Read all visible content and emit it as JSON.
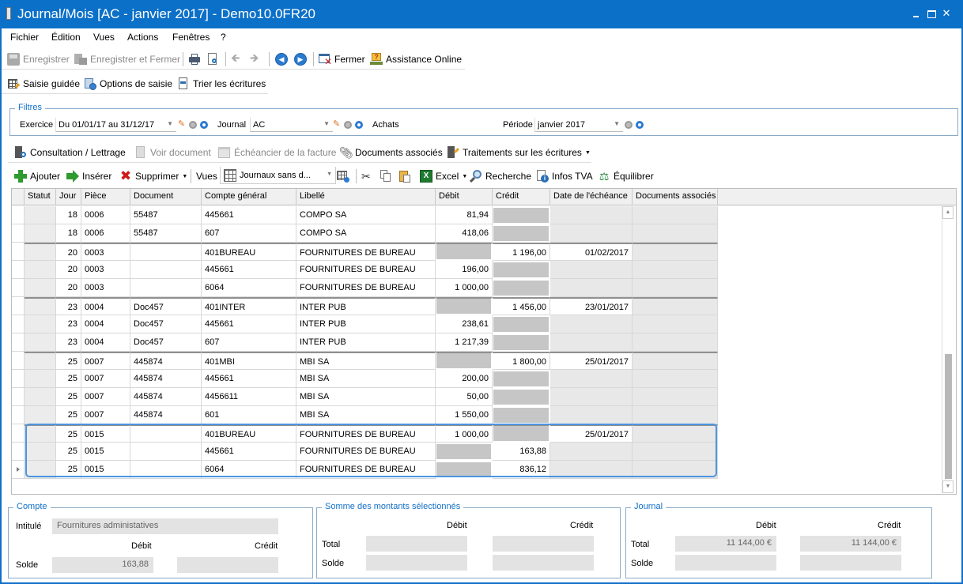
{
  "window": {
    "title": "Journal/Mois [AC - janvier 2017] - Demo10.0FR20",
    "controls": {
      "minimize": "minimize",
      "maximize": "maximize",
      "close": "✕"
    }
  },
  "menu": [
    "Fichier",
    "Édition",
    "Vues",
    "Actions",
    "Fenêtres",
    "?"
  ],
  "toolbar1": {
    "save": "Enregistrer",
    "save_close": "Enregistrer et Fermer",
    "close": "Fermer",
    "assistance": "Assistance Online"
  },
  "toolbar2": {
    "guided": "Saisie guidée",
    "options": "Options de saisie",
    "sort": "Trier les écritures"
  },
  "filters": {
    "legend": "Filtres",
    "exercice_label": "Exercice",
    "exercice_value": "Du 01/01/17 au 31/12/17",
    "journal_label": "Journal",
    "journal_value": "AC",
    "journal_name": "Achats",
    "periode_label": "Période",
    "periode_value": "janvier 2017"
  },
  "actions": {
    "consultation": "Consultation / Lettrage",
    "voir_document": "Voir document",
    "echeancier": "Échéancier de la facture",
    "documents": "Documents associés",
    "traitements": "Traitements sur les écritures"
  },
  "edit": {
    "add": "Ajouter",
    "insert": "Insérer",
    "delete": "Supprimer",
    "vues_label": "Vues",
    "vues_value": "Journaux sans d...",
    "excel": "Excel",
    "search": "Recherche",
    "tva": "Infos TVA",
    "balance": "Équilibrer"
  },
  "grid": {
    "columns": [
      "Statut",
      "Jour",
      "Pièce",
      "Document",
      "Compte général",
      "Libellé",
      "Débit",
      "Crédit",
      "Date de l'échéance",
      "Documents associés"
    ],
    "rows": [
      {
        "jour": "18",
        "piece": "0006",
        "document": "55487",
        "compte": "445661",
        "libelle": "COMPO SA",
        "debit": "81,94",
        "credit": "",
        "echeance": ""
      },
      {
        "jour": "18",
        "piece": "0006",
        "document": "55487",
        "compte": "607",
        "libelle": "COMPO SA",
        "debit": "418,06",
        "credit": "",
        "echeance": ""
      },
      {
        "jour": "20",
        "piece": "0003",
        "document": "",
        "compte": "401BUREAU",
        "libelle": "FOURNITURES DE BUREAU",
        "debit": "",
        "credit": "1 196,00",
        "echeance": "01/02/2017"
      },
      {
        "jour": "20",
        "piece": "0003",
        "document": "",
        "compte": "445661",
        "libelle": "FOURNITURES DE BUREAU",
        "debit": "196,00",
        "credit": "",
        "echeance": ""
      },
      {
        "jour": "20",
        "piece": "0003",
        "document": "",
        "compte": "6064",
        "libelle": "FOURNITURES DE BUREAU",
        "debit": "1 000,00",
        "credit": "",
        "echeance": ""
      },
      {
        "jour": "23",
        "piece": "0004",
        "document": "Doc457",
        "compte": "401INTER",
        "libelle": "INTER PUB",
        "debit": "",
        "credit": "1 456,00",
        "echeance": "23/01/2017"
      },
      {
        "jour": "23",
        "piece": "0004",
        "document": "Doc457",
        "compte": "445661",
        "libelle": "INTER PUB",
        "debit": "238,61",
        "credit": "",
        "echeance": ""
      },
      {
        "jour": "23",
        "piece": "0004",
        "document": "Doc457",
        "compte": "607",
        "libelle": "INTER PUB",
        "debit": "1 217,39",
        "credit": "",
        "echeance": ""
      },
      {
        "jour": "25",
        "piece": "0007",
        "document": "445874",
        "compte": "401MBI",
        "libelle": "MBI SA",
        "debit": "",
        "credit": "1 800,00",
        "echeance": "25/01/2017"
      },
      {
        "jour": "25",
        "piece": "0007",
        "document": "445874",
        "compte": "445661",
        "libelle": "MBI SA",
        "debit": "200,00",
        "credit": "",
        "echeance": ""
      },
      {
        "jour": "25",
        "piece": "0007",
        "document": "445874",
        "compte": "4456611",
        "libelle": "MBI SA",
        "debit": "50,00",
        "credit": "",
        "echeance": ""
      },
      {
        "jour": "25",
        "piece": "0007",
        "document": "445874",
        "compte": "601",
        "libelle": "MBI SA",
        "debit": "1 550,00",
        "credit": "",
        "echeance": ""
      },
      {
        "jour": "25",
        "piece": "0015",
        "document": "",
        "compte": "401BUREAU",
        "libelle": "FOURNITURES DE BUREAU",
        "debit": "1 000,00",
        "credit": "",
        "echeance": "25/01/2017"
      },
      {
        "jour": "25",
        "piece": "0015",
        "document": "",
        "compte": "445661",
        "libelle": "FOURNITURES DE BUREAU",
        "debit": "",
        "credit": "163,88",
        "echeance": ""
      },
      {
        "jour": "25",
        "piece": "0015",
        "document": "",
        "compte": "6064",
        "libelle": "FOURNITURES DE BUREAU",
        "debit": "",
        "credit": "836,12",
        "echeance": ""
      }
    ]
  },
  "compte_panel": {
    "legend": "Compte",
    "intitule_label": "Intitulé",
    "intitule_value": "Fournitures administatives",
    "debit_label": "Débit",
    "credit_label": "Crédit",
    "solde_label": "Solde",
    "solde_debit": "163,88",
    "solde_credit": ""
  },
  "somme_panel": {
    "legend": "Somme des montants sélectionnés",
    "debit_label": "Débit",
    "credit_label": "Crédit",
    "total_label": "Total",
    "solde_label": "Solde",
    "total_debit": "",
    "total_credit": "",
    "solde_debit": "",
    "solde_credit": ""
  },
  "journal_panel": {
    "legend": "Journal",
    "debit_label": "Débit",
    "credit_label": "Crédit",
    "total_label": "Total",
    "solde_label": "Solde",
    "total_debit": "11 144,00 €",
    "total_credit": "11 144,00 €",
    "solde_debit": "",
    "solde_credit": ""
  }
}
